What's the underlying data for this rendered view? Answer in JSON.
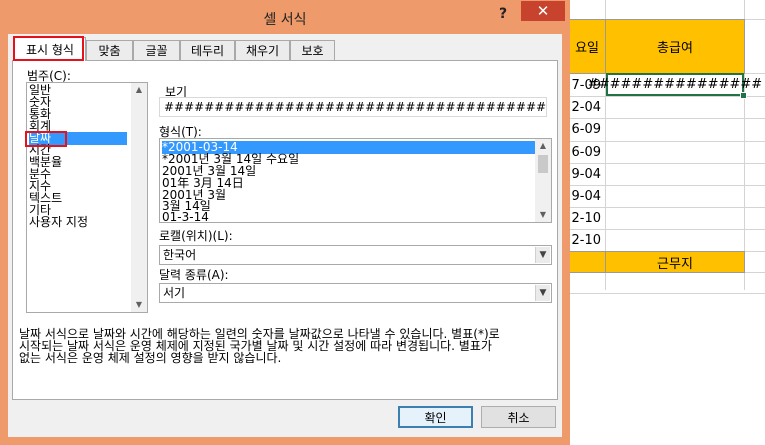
{
  "spreadsheet": {
    "header_date_fragment": "요일",
    "header_total_pay": "총급여",
    "selected_cell_value": "################",
    "date_fragments": [
      "7-09",
      "2-04",
      "6-09",
      "6-09",
      "9-04",
      "9-04",
      "2-10",
      "2-10"
    ],
    "footer_label": "근무지"
  },
  "dialog": {
    "title": "셀 서식",
    "help_label": "?",
    "close_label": "✕",
    "tabs": [
      "표시 형식",
      "맞춤",
      "글꼴",
      "테두리",
      "채우기",
      "보호"
    ],
    "category": {
      "label": "범주(C):",
      "items": [
        "일반",
        "숫자",
        "통화",
        "회계",
        "날짜",
        "시간",
        "백분율",
        "분수",
        "지수",
        "텍스트",
        "기타",
        "사용자 지정"
      ],
      "selected": "날짜"
    },
    "sample": {
      "label": "보기",
      "value": "################################################################"
    },
    "type": {
      "label": "형식(T):",
      "items": [
        "*2001-03-14",
        "*2001년 3월 14일 수요일",
        "2001년 3월 14일",
        "01年 3月 14日",
        "2001년 3월",
        "3월 14일",
        "01-3-14"
      ],
      "selected": "*2001-03-14"
    },
    "locale": {
      "label": "로캘(위치)(L):",
      "value": "한국어"
    },
    "calendar": {
      "label": "달력 종류(A):",
      "value": "서기"
    },
    "description": [
      "날짜 서식으로 날짜와 시간에 해당하는 일련의 숫자를 날짜값으로 나타낼 수 있습니다. 별표(*)로",
      "시작되는 날짜 서식은 운영 체제에 지정된 국가별 날짜 및 시간 설정에 따라 변경됩니다. 별표가",
      "없는 서식은 운영 체제 설정의 영향을 받지 않습니다."
    ],
    "ok_label": "확인",
    "cancel_label": "취소"
  },
  "colors": {
    "dialog_frame": "#ef9a6a",
    "close_button": "#c8432d",
    "selection_blue": "#3399ff",
    "highlight_red": "#e5121c",
    "cell_orange": "#ffc000",
    "excel_green": "#217346"
  }
}
